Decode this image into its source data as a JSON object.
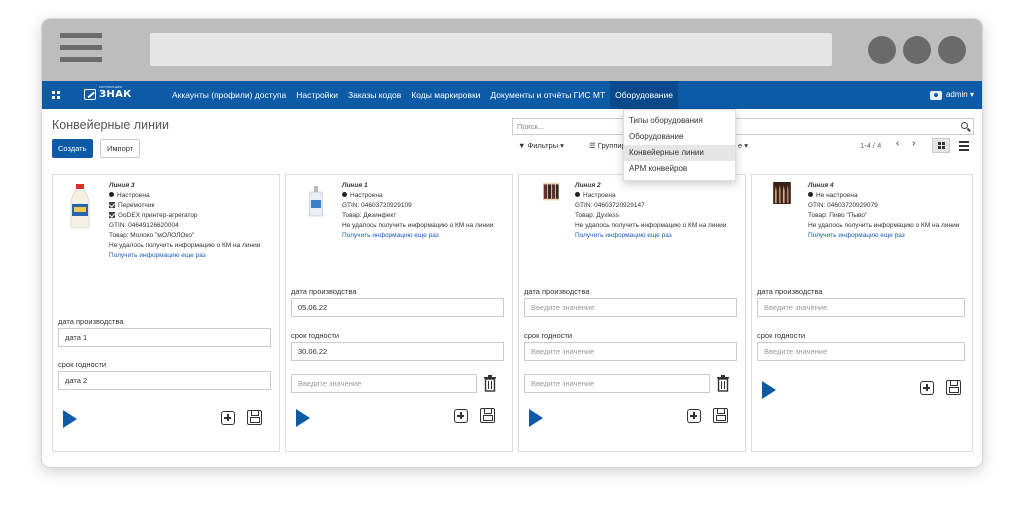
{
  "navbar": {
    "logo_small": "КОРПОРАЦИЯ",
    "logo_text": "ЗНАК",
    "menu": [
      "Аккаунты (профили) доступа",
      "Настройки",
      "Заказы кодов",
      "Коды маркировки",
      "Документы и отчёты ГИС МТ",
      "Оборудование"
    ],
    "user": "admin ▾"
  },
  "control": {
    "title": "Конвейерные линии",
    "create": "Создать",
    "import": "Импорт",
    "search_placeholder": "Поиск...",
    "filters": "▼ Фильтры ▾",
    "groupby": "☰ Группировка",
    "fav_caret": "е ▾",
    "pager": "1-4 / 4",
    "prev": "‹",
    "next": "›"
  },
  "dropdown": {
    "items": [
      "Типы оборудования",
      "Оборудование",
      "Конвейерные линии",
      "АРМ конвейров"
    ],
    "active_index": 2
  },
  "cards": [
    {
      "name": "Линия 3",
      "status": "Настроена",
      "checks": [
        "Перемотчик",
        "GoDEX принтер-агрегатор"
      ],
      "gtin": "GTIN: 04649126620004",
      "product": "Товар: Молоко \"мОЛОЛОко\"",
      "error": "Не удалось получить информацию о КМ на линии",
      "retry": "Получить информацию еще раз",
      "prod_date_label": "дата производства",
      "prod_date_value": "дата 1",
      "expiry_label": "срок годности",
      "expiry_value": "дата 2"
    },
    {
      "name": "Линия 1",
      "status": "Настроена",
      "gtin": "GTIN: 04603720929109",
      "product": "Товар: Дезинфект",
      "error": "Не удалось получить информацию о КМ на линии",
      "retry": "Получить информацию еще раз",
      "prod_date_label": "дата производства",
      "prod_date_value": "05.06.22",
      "expiry_label": "срок годности",
      "expiry_value": "30.06.22",
      "extra_placeholder": "Введите значение"
    },
    {
      "name": "Линия 2",
      "status": "Настроена",
      "gtin": "GTIN: 04603720929147",
      "product": "Товар: Дуxless",
      "error": "Не удалось получить информацию о КМ на линии",
      "retry": "Получить информацию еще раз",
      "prod_date_label": "дата производства",
      "prod_date_placeholder": "Введите значение",
      "expiry_label": "срок годности",
      "expiry_placeholder": "Введите значение",
      "extra_placeholder": "Введите значение"
    },
    {
      "name": "Линия 4",
      "status": "Не настроена",
      "gtin": "GTIN: 04603720929079",
      "product": "Товар: Пиво \"Пыво\"",
      "error": "Не удалось получить информацию о КМ на линии",
      "retry": "Получить информацию еще раз",
      "prod_date_label": "дата производства",
      "prod_date_placeholder": "Введите значение",
      "expiry_label": "срок годности",
      "expiry_placeholder": "Введите значение"
    }
  ],
  "colors": {
    "brand": "#0d5aa7",
    "link": "#1b5fb8"
  }
}
